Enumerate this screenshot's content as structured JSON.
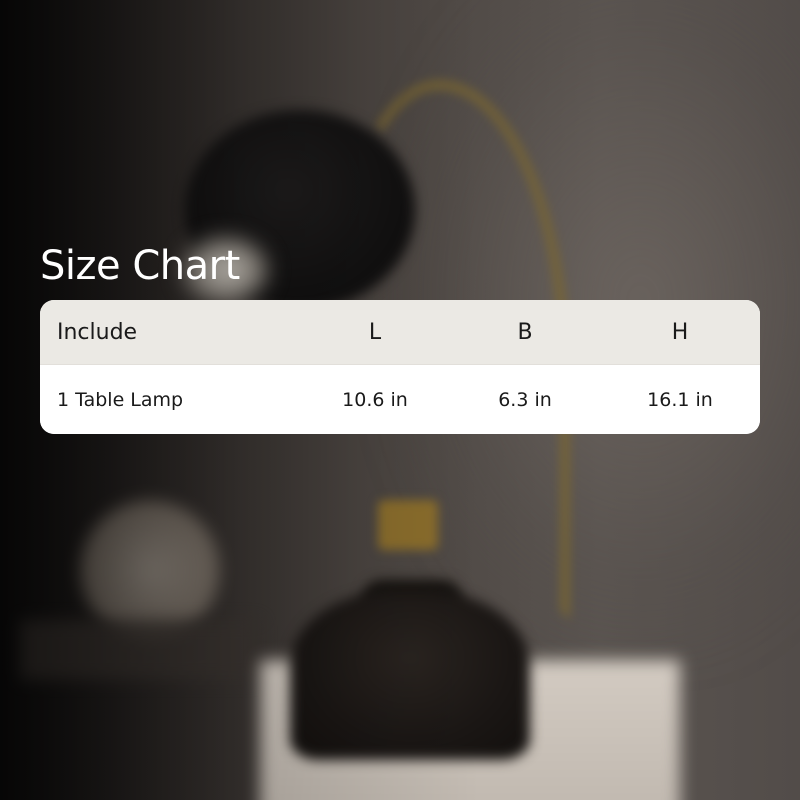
{
  "title": "Size Chart",
  "table": {
    "headers": [
      "Include",
      "L",
      "B",
      "H"
    ],
    "rows": [
      [
        "1 Table Lamp",
        "10.6 in",
        "6.3 in",
        "16.1 in"
      ]
    ]
  },
  "colors": {
    "header_bg": "#ebe9e4",
    "row_bg": "#ffffff",
    "title_text": "#ffffff",
    "table_text": "#1a1a1a"
  }
}
